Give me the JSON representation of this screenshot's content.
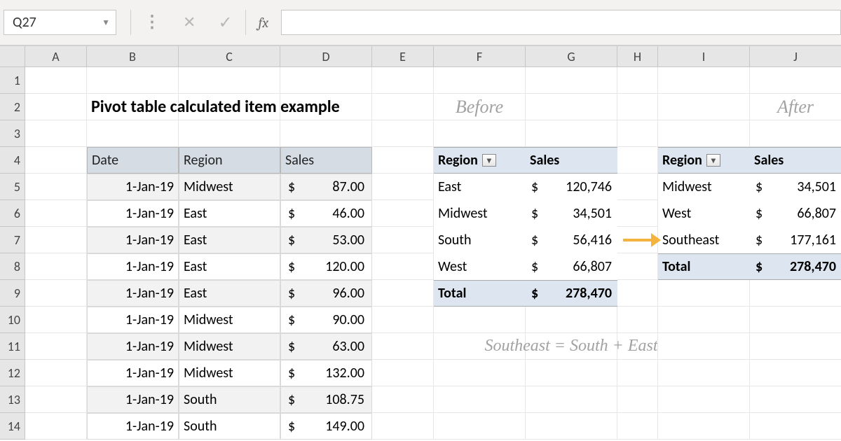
{
  "name_box": "Q27",
  "fx_label": "fx",
  "columns": [
    "A",
    "B",
    "C",
    "D",
    "E",
    "F",
    "G",
    "H",
    "I",
    "J"
  ],
  "rows": [
    "1",
    "2",
    "3",
    "4",
    "5",
    "6",
    "7",
    "8",
    "9",
    "10",
    "11",
    "12",
    "13",
    "14"
  ],
  "title": "Pivot table calculated item example",
  "before_label": "Before",
  "after_label": "After",
  "table": {
    "headers": {
      "date": "Date",
      "region": "Region",
      "sales": "Sales"
    },
    "rows": [
      {
        "date": "1-Jan-19",
        "region": "Midwest",
        "sales": "87.00"
      },
      {
        "date": "1-Jan-19",
        "region": "East",
        "sales": "46.00"
      },
      {
        "date": "1-Jan-19",
        "region": "East",
        "sales": "53.00"
      },
      {
        "date": "1-Jan-19",
        "region": "East",
        "sales": "120.00"
      },
      {
        "date": "1-Jan-19",
        "region": "East",
        "sales": "96.00"
      },
      {
        "date": "1-Jan-19",
        "region": "Midwest",
        "sales": "90.00"
      },
      {
        "date": "1-Jan-19",
        "region": "Midwest",
        "sales": "63.00"
      },
      {
        "date": "1-Jan-19",
        "region": "Midwest",
        "sales": "132.00"
      },
      {
        "date": "1-Jan-19",
        "region": "South",
        "sales": "108.75"
      },
      {
        "date": "1-Jan-19",
        "region": "South",
        "sales": "149.00"
      }
    ]
  },
  "pivot_before": {
    "headers": {
      "region": "Region",
      "sales": "Sales"
    },
    "rows": [
      {
        "region": "East",
        "sales": "120,746"
      },
      {
        "region": "Midwest",
        "sales": "34,501"
      },
      {
        "region": "South",
        "sales": "56,416"
      },
      {
        "region": "West",
        "sales": "66,807"
      }
    ],
    "total": {
      "label": "Total",
      "sales": "278,470"
    }
  },
  "pivot_after": {
    "headers": {
      "region": "Region",
      "sales": "Sales"
    },
    "rows": [
      {
        "region": "Midwest",
        "sales": "34,501"
      },
      {
        "region": "West",
        "sales": "66,807"
      },
      {
        "region": "Southeast",
        "sales": "177,161"
      }
    ],
    "total": {
      "label": "Total",
      "sales": "278,470"
    }
  },
  "equation": "Southeast = South + East",
  "currency": "$"
}
